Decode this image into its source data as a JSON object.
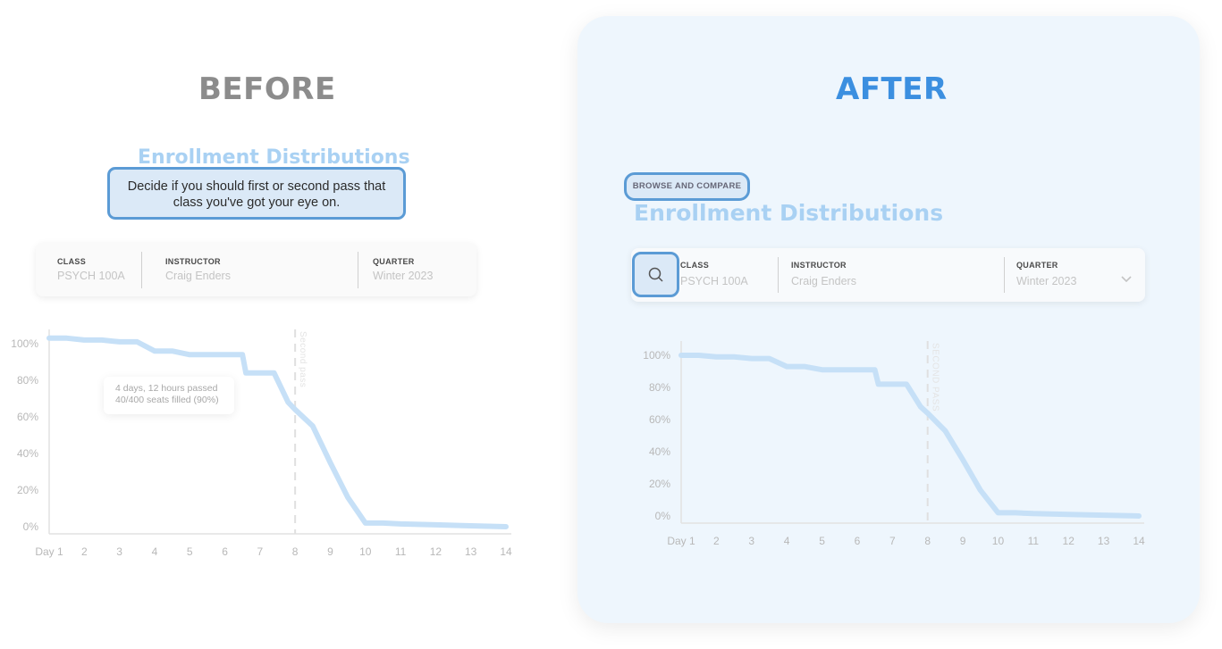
{
  "before": {
    "heading": "BEFORE",
    "enroll_title": "Enrollment Distributions",
    "callout_line1": "Decide if you should first or second pass that",
    "callout_line2": "class you've got your eye on.",
    "filters": {
      "class_label": "CLASS",
      "class_value": "PSYCH 100A",
      "instructor_label": "INSTRUCTOR",
      "instructor_value": "Craig Enders",
      "quarter_label": "QUARTER",
      "quarter_value": "Winter 2023"
    },
    "second_pass_label": "Second pass",
    "tooltip_line1": "4 days, 12 hours passed",
    "tooltip_line2": "40/400 seats filled (90%)"
  },
  "after": {
    "heading": "AFTER",
    "browse_chip": "BROWSE AND COMPARE",
    "enroll_title": "Enrollment Distributions",
    "filters": {
      "class_label": "CLASS",
      "class_value": "PSYCH 100A",
      "instructor_label": "INSTRUCTOR",
      "instructor_value": "Craig Enders",
      "quarter_label": "QUARTER",
      "quarter_value": "Winter 2023"
    },
    "second_pass_label": "SECOND PASS"
  },
  "colors": {
    "before_heading": "#8c8c8c",
    "after_heading": "#3b8fe0",
    "highlight_border": "#5b9bd5",
    "curve": "#c6e0f7",
    "panel_bg": "#eef6fd"
  },
  "icons": {
    "search": "search-icon",
    "dropdown": "chevron-down-icon"
  },
  "chart_data": [
    {
      "type": "line",
      "name": "before-chart",
      "x_ticks": [
        "Day 1",
        "2",
        "3",
        "4",
        "5",
        "6",
        "7",
        "8",
        "9",
        "10",
        "11",
        "12",
        "13",
        "14"
      ],
      "y_ticks": [
        "100%",
        "80%",
        "60%",
        "40%",
        "20%",
        "0%"
      ],
      "ylim": [
        0,
        100
      ],
      "x": [
        1,
        1.5,
        2,
        2.5,
        3,
        3.5,
        4,
        4.5,
        5,
        5.5,
        6,
        6.5,
        6.6,
        7,
        7.4,
        7.8,
        8,
        8.5,
        9,
        9.5,
        10,
        10.5,
        11,
        12,
        13,
        14
      ],
      "values": [
        103,
        103,
        102,
        102,
        101,
        101,
        96,
        96,
        94,
        94,
        94,
        94,
        84,
        84,
        84,
        68,
        64,
        55,
        35,
        16,
        2,
        2,
        1.5,
        1,
        0.5,
        0
      ],
      "annotation_day": 8
    },
    {
      "type": "line",
      "name": "after-chart",
      "x_ticks": [
        "Day 1",
        "2",
        "3",
        "4",
        "5",
        "6",
        "7",
        "8",
        "9",
        "10",
        "11",
        "12",
        "13",
        "14"
      ],
      "y_ticks": [
        "100%",
        "80%",
        "60%",
        "40%",
        "20%",
        "0%"
      ],
      "ylim": [
        0,
        100
      ],
      "x": [
        1,
        1.5,
        2,
        2.5,
        3,
        3.5,
        4,
        4.5,
        5,
        5.5,
        6,
        6.5,
        6.6,
        7,
        7.4,
        7.8,
        8,
        8.5,
        9,
        9.5,
        10,
        10.5,
        11,
        12,
        13,
        14
      ],
      "values": [
        100,
        100,
        99,
        99,
        98,
        98,
        93,
        93,
        91,
        91,
        91,
        91,
        82,
        82,
        82,
        68,
        64,
        53,
        35,
        16,
        2,
        2,
        1.5,
        1,
        0.5,
        0
      ],
      "annotation_day": 8
    }
  ]
}
